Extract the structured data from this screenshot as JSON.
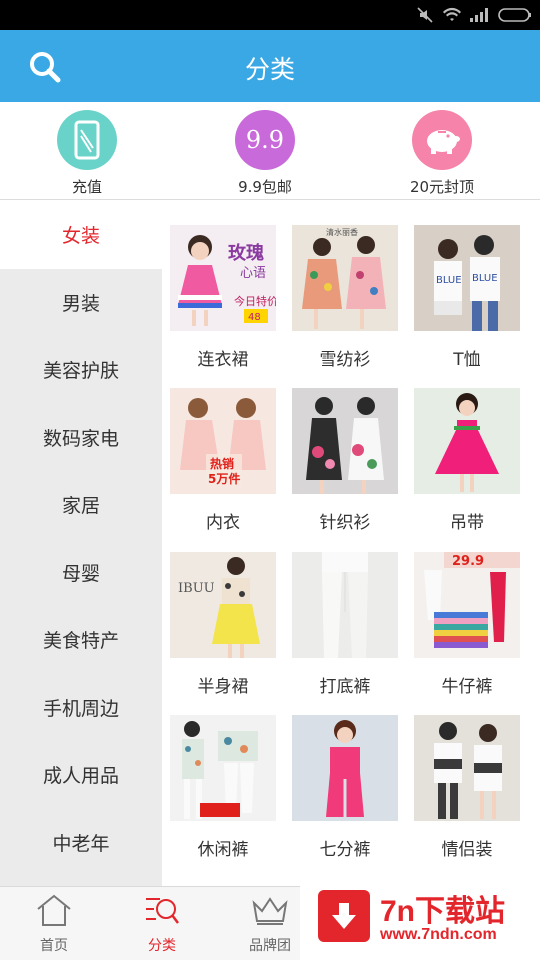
{
  "header": {
    "title": "分类",
    "search_icon": "search-icon"
  },
  "quick_links": [
    {
      "label": "充值",
      "icon": "phone-icon",
      "color": "#6ad3c9"
    },
    {
      "label": "9.9包邮",
      "icon": "nine-nine-icon",
      "icon_text": "9.9",
      "color": "#c86ad9"
    },
    {
      "label": "20元封顶",
      "icon": "piggy-bank-icon",
      "color": "#f583aa"
    }
  ],
  "sidebar": {
    "items": [
      {
        "label": "女装",
        "active": true
      },
      {
        "label": "男装"
      },
      {
        "label": "美容护肤"
      },
      {
        "label": "数码家电"
      },
      {
        "label": "家居"
      },
      {
        "label": "母婴"
      },
      {
        "label": "美食特产"
      },
      {
        "label": "手机周边"
      },
      {
        "label": "成人用品"
      },
      {
        "label": "中老年"
      }
    ]
  },
  "categories": [
    {
      "label": "连衣裙",
      "overlay": [
        "玫瑰",
        "心语",
        "今日特价",
        "48"
      ]
    },
    {
      "label": "雪纺衫",
      "overlay": [
        "清水丽香"
      ]
    },
    {
      "label": "T恤",
      "overlay": [
        "BLUE",
        "BLUE"
      ]
    },
    {
      "label": "内衣",
      "overlay": [
        "热销",
        "5万件"
      ]
    },
    {
      "label": "针织衫"
    },
    {
      "label": "吊带"
    },
    {
      "label": "半身裙",
      "overlay": [
        "IBUU"
      ]
    },
    {
      "label": "打底裤"
    },
    {
      "label": "牛仔裤",
      "overlay": [
        "29.9"
      ]
    },
    {
      "label": "休闲裤"
    },
    {
      "label": "七分裤"
    },
    {
      "label": "情侣装"
    }
  ],
  "tabbar": {
    "tabs": [
      {
        "label": "首页",
        "icon": "home-icon"
      },
      {
        "label": "分类",
        "icon": "category-search-icon",
        "active": true
      },
      {
        "label": "品牌团",
        "icon": "crown-icon"
      }
    ]
  },
  "watermark": {
    "title": "7n下载站",
    "url": "www.7ndn.com"
  },
  "colors": {
    "header": "#3aa8e4",
    "accent": "#e3262c",
    "sidebar_bg": "#ebebeb"
  }
}
